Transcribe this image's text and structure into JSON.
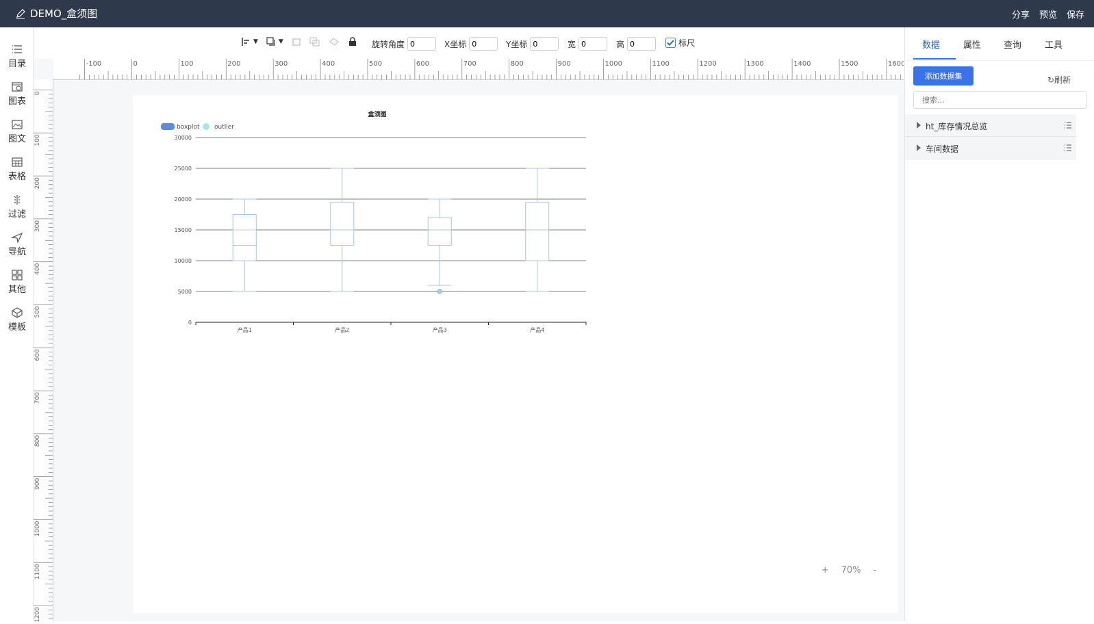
{
  "app": {
    "title": "DEMO_盒须图"
  },
  "header_actions": [
    "分享",
    "预览",
    "保存"
  ],
  "sidebar": {
    "items": [
      {
        "label": "目录",
        "icon": "list-icon"
      },
      {
        "label": "图表",
        "icon": "chart-icon"
      },
      {
        "label": "图文",
        "icon": "image-text-icon"
      },
      {
        "label": "表格",
        "icon": "table-icon"
      },
      {
        "label": "过滤",
        "icon": "filter-icon"
      },
      {
        "label": "导航",
        "icon": "navigate-icon"
      },
      {
        "label": "其他",
        "icon": "grid-icon"
      },
      {
        "label": "模板",
        "icon": "template-icon"
      }
    ]
  },
  "toolbar": {
    "rotation_label": "旋转角度",
    "rotation_value": "0",
    "x_label": "X坐标",
    "x_value": "0",
    "y_label": "Y坐标",
    "y_value": "0",
    "width_label": "宽",
    "width_value": "0",
    "height_label": "高",
    "height_value": "0",
    "ruler_label": "标尺",
    "ruler_checked": true
  },
  "ruler": {
    "h_labels": [
      "-100",
      "0",
      "100",
      "200",
      "300",
      "400",
      "500",
      "600",
      "700",
      "800",
      "900",
      "1000",
      "1100",
      "1200",
      "1300",
      "1400",
      "1500",
      "1600"
    ],
    "v_labels": [
      "0",
      "100",
      "200",
      "300",
      "400",
      "500",
      "600",
      "700",
      "800",
      "900",
      "1000",
      "1100",
      "1200"
    ]
  },
  "right_panel": {
    "tabs": [
      "数据",
      "属性",
      "查询",
      "工具"
    ],
    "active_tab": "数据",
    "add_dataset_label": "添加数据集",
    "refresh_label": "刷新",
    "search_placeholder": "搜索...",
    "datasets": [
      "ht_库存情况总览",
      "车间数据"
    ]
  },
  "zoom": {
    "plus": "+",
    "value": "70%",
    "minus": "-"
  },
  "chart_data": {
    "type": "boxplot",
    "title": "盒须图",
    "legend": [
      "boxplot",
      "outlier"
    ],
    "legend_placement": "top-left",
    "categories": [
      "产品1",
      "产品2",
      "产品3",
      "产品4"
    ],
    "ylim": [
      0,
      30000
    ],
    "yticks": [
      0,
      5000,
      10000,
      15000,
      20000,
      25000,
      30000
    ],
    "boxes": [
      {
        "min": 5000,
        "q1": 10000,
        "median": 12500,
        "q3": 17500,
        "max": 20000
      },
      {
        "min": 5000,
        "q1": 12500,
        "median": 15000,
        "q3": 19500,
        "max": 25000
      },
      {
        "min": 6000,
        "q1": 12500,
        "median": 15000,
        "q3": 17000,
        "max": 20000
      },
      {
        "min": 5000,
        "q1": 10000,
        "median": 15000,
        "q3": 19500,
        "max": 25000
      }
    ],
    "outliers": [
      {
        "category": "产品3",
        "value": 5000
      }
    ],
    "grid": true,
    "colors": {
      "box": "#a8c4e8",
      "outlier": "#9fd6ee",
      "legend_box": "#5b8ddc",
      "legend_outlier": "#a7e3ec"
    }
  }
}
